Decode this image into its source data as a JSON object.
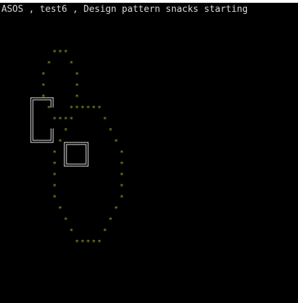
{
  "console": {
    "title": "ASOS , test6 , Design pattern snacks starting",
    "text_color": "#d8d8d8",
    "background": "#000000"
  },
  "snake": {
    "glyph": "*",
    "color": "#9a9a2a",
    "rows": [
      "***",
      "*   *",
      "*     *",
      "*     *",
      "*     *",
      "*     ******",
      "****       *",
      "*           *",
      "*            *",
      "*           *",
      "*           *",
      "*           *",
      "*           *",
      "*         *",
      "*       *",
      "*     *",
      "*****"
    ]
  },
  "objects": [
    {
      "kind": "wall-bracket",
      "color": "#e8e8e8"
    },
    {
      "kind": "food-box",
      "color": "#e8e8e8"
    }
  ]
}
